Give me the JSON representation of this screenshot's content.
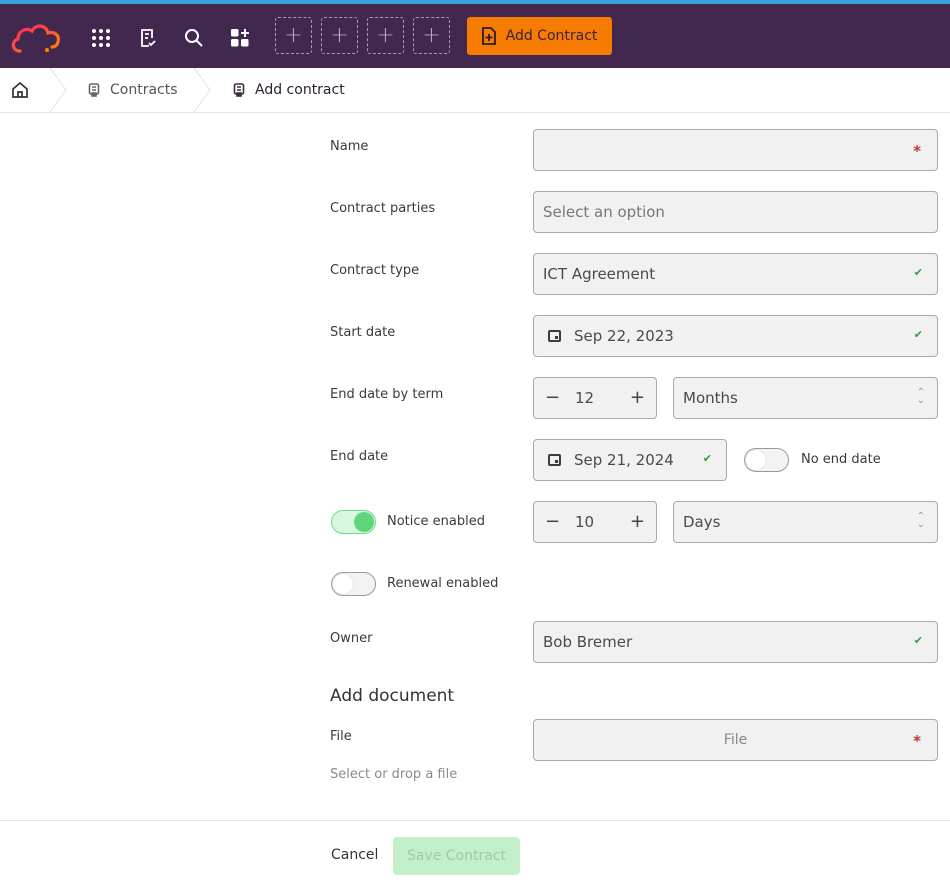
{
  "topbar": {
    "logo": "cloud-logo",
    "icons": [
      "apps-grid-icon",
      "checklist-icon",
      "search-icon",
      "add-widget-icon"
    ],
    "shortcut_slots": [
      "+",
      "+",
      "+",
      "+"
    ],
    "add_contract_label": "Add Contract",
    "add_contract_icon": "file-plus-icon"
  },
  "breadcrumb": {
    "home_icon": "home-icon",
    "items": [
      {
        "label": "Contracts",
        "icon": "contract-icon"
      },
      {
        "label": "Add contract",
        "icon": "contract-icon"
      }
    ]
  },
  "form": {
    "name": {
      "label": "Name",
      "value": "",
      "required": true
    },
    "contract_parties": {
      "label": "Contract parties",
      "placeholder": "Select an option"
    },
    "contract_type": {
      "label": "Contract type",
      "value": "ICT Agreement",
      "valid": true
    },
    "start_date": {
      "label": "Start date",
      "value": "Sep 22, 2023",
      "valid": true
    },
    "end_date_by_term": {
      "label": "End date by term",
      "amount": "12",
      "unit": "Months"
    },
    "end_date": {
      "label": "End date",
      "value": "Sep 21, 2024",
      "valid": true,
      "no_end_date_label": "No end date",
      "no_end_date": false
    },
    "notice": {
      "label": "Notice enabled",
      "enabled": true,
      "amount": "10",
      "unit": "Days"
    },
    "renewal": {
      "label": "Renewal enabled",
      "enabled": false
    },
    "owner": {
      "label": "Owner",
      "value": "Bob Bremer",
      "valid": true
    },
    "document": {
      "section_title": "Add document",
      "file_label": "File",
      "file_placeholder": "File",
      "required": true,
      "hint": "Select or drop a file"
    }
  },
  "symbols": {
    "required": "*",
    "check": "✔",
    "minus": "−",
    "plus": "+",
    "updown_up": "⌃",
    "updown_down": "⌄"
  },
  "footer": {
    "cancel_label": "Cancel",
    "save_label": "Save Contract"
  },
  "colors": {
    "topbar": "#42284f",
    "accent": "#f57c00",
    "save_disabled": "#c3f0cb",
    "toggle_on": "#5fd67c",
    "required": "#c0392b",
    "valid": "#2e9e3a"
  }
}
